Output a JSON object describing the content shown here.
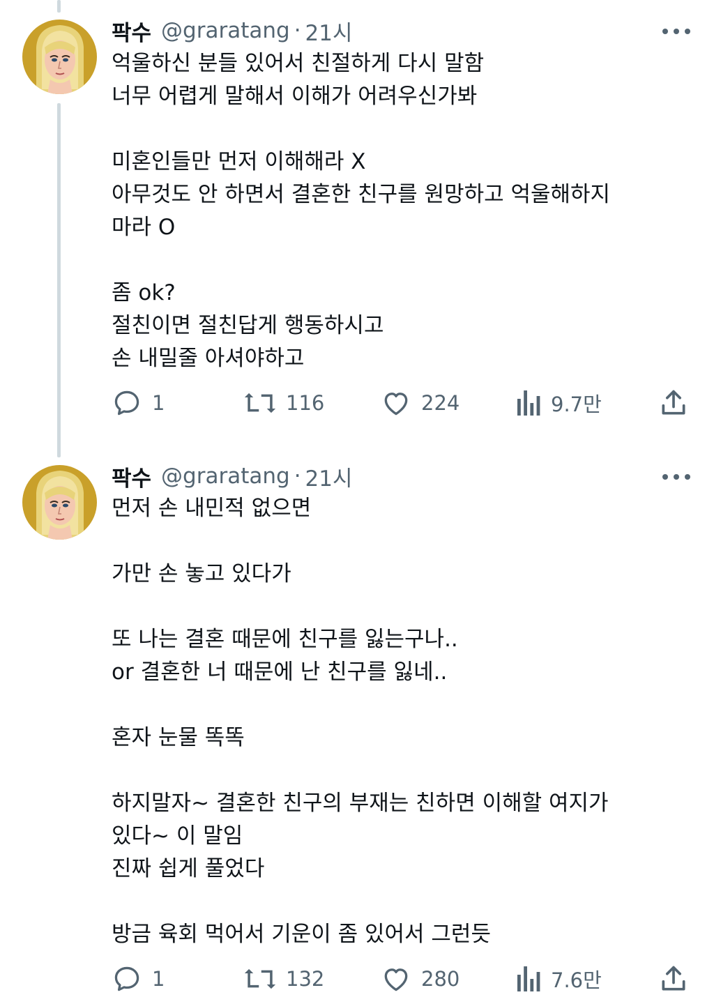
{
  "tweets": [
    {
      "name": "팍수",
      "handle": "@graratang",
      "separator": "·",
      "time": "21시",
      "lines": [
        "억울하신 분들 있어서 친절하게 다시 말함",
        "너무 어렵게 말해서 이해가 어려우신가봐",
        "",
        "미혼인들만 먼저 이해해라 X",
        "아무것도 안 하면서 결혼한 친구를 원망하고 억울해하지",
        "마라 O",
        "",
        "좀 ok?",
        "절친이면 절친답게 행동하시고",
        "손 내밀줄 아셔야하고"
      ],
      "replies": "1",
      "retweets": "116",
      "likes": "224",
      "views": "9.7만"
    },
    {
      "name": "팍수",
      "handle": "@graratang",
      "separator": "·",
      "time": "21시",
      "lines": [
        "먼저 손 내민적 없으면",
        "",
        "가만 손 놓고 있다가",
        "",
        "또 나는 결혼 때문에 친구를 잃는구나..",
        "or 결혼한 너 때문에 난 친구를 잃네..",
        "",
        "혼자 눈물 똑똑",
        "",
        "하지말자~ 결혼한 친구의 부재는 친하면 이해할 여지가",
        "있다~ 이 말임",
        "진짜 쉽게 풀었다",
        "",
        "방금 육회 먹어서 기운이 좀 있어서 그런듯"
      ],
      "replies": "1",
      "retweets": "132",
      "likes": "280",
      "views": "7.6만"
    }
  ],
  "icons": {
    "reply": "reply-bubble-icon",
    "retweet": "retweet-arrows-icon",
    "like": "heart-icon",
    "views": "bar-chart-icon",
    "share": "share-upload-icon",
    "more": "more-dots-icon"
  },
  "colors": {
    "text": "#0f1419",
    "secondary": "#536471",
    "thread_line": "#cfd9de",
    "avatar_bg": "#c9a02a"
  }
}
